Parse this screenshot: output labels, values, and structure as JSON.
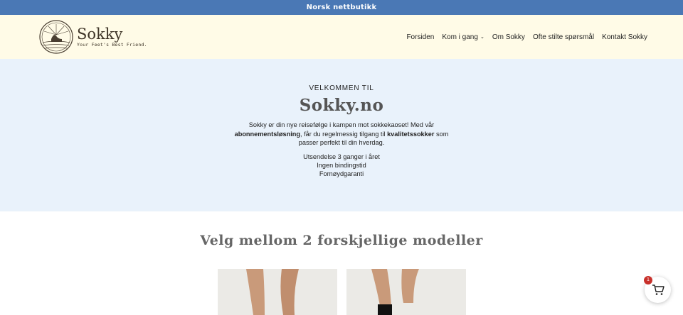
{
  "topbar": {
    "text": "Norsk nettbutikk"
  },
  "logo": {
    "name": "Sokky",
    "tagline": "Your Feet's Best Friend."
  },
  "nav": {
    "items": [
      {
        "label": "Forsiden"
      },
      {
        "label": "Kom i gang",
        "dropdown": true
      },
      {
        "label": "Om Sokky"
      },
      {
        "label": "Ofte stilte spørsmål"
      },
      {
        "label": "Kontakt Sokky"
      }
    ]
  },
  "hero": {
    "eyebrow": "VELKOMMEN TIL",
    "title": "Sokky.no",
    "desc_part1": "Sokky er din nye reisefølge i kampen mot sokkekaoset! Med vår ",
    "desc_bold1": "abonnementsløsning",
    "desc_part2": ", får du regelmessig tilgang til ",
    "desc_bold2": "kvalitetssokker",
    "desc_part3": " som passer perfekt til din hverdag.",
    "features": [
      "Utsendelse 3 ganger i året",
      "Ingen bindingstid",
      "Fornøydgaranti"
    ]
  },
  "section": {
    "title": "Velg mellom 2 forskjellige modeller"
  },
  "cart": {
    "count": "1",
    "icon": "cart-icon"
  },
  "colors": {
    "topbar": "#4a78b5",
    "header_bg": "#fffbe7",
    "hero_bg": "#e9f2fb",
    "badge": "#c8302a"
  }
}
